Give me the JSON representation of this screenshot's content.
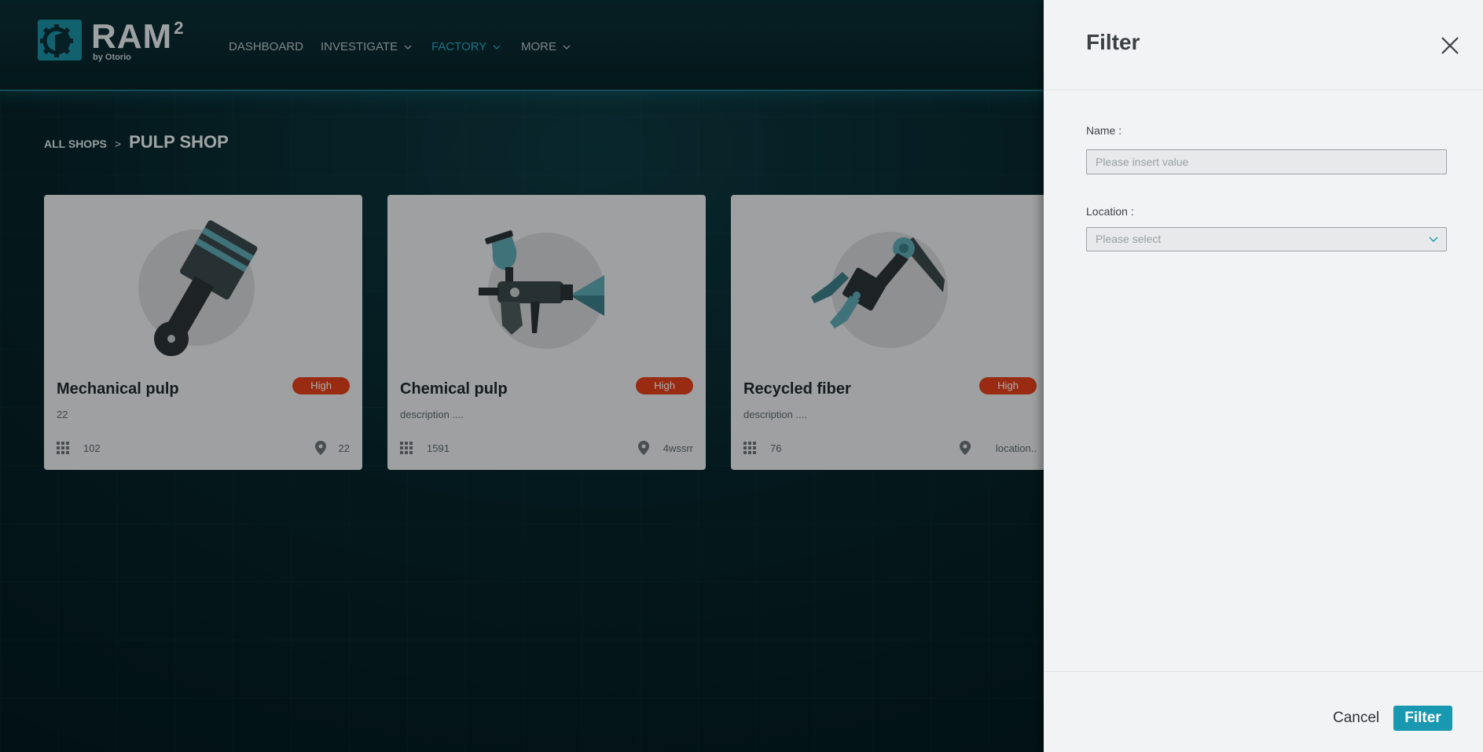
{
  "brand": {
    "name": "RAM",
    "superscript": "2",
    "byline": "by Otorio"
  },
  "nav": {
    "dashboard": "DASHBOARD",
    "investigate": "INVESTIGATE",
    "factory": "FACTORY",
    "more": "MORE",
    "active": "factory",
    "accent_color": "#2aa8c0"
  },
  "breadcrumb": {
    "parent": "ALL SHOPS",
    "separator": ">",
    "current": "PULP SHOP"
  },
  "cards": [
    {
      "title": "Mechanical pulp",
      "badge": "High",
      "description": "22",
      "count": "102",
      "location": "22",
      "icon": "piston-icon"
    },
    {
      "title": "Chemical pulp",
      "badge": "High",
      "description": "description ....",
      "count": "1591",
      "location": "4wssrr",
      "icon": "spray-gun-icon"
    },
    {
      "title": "Recycled fiber",
      "badge": "High",
      "description": "description ....",
      "count": "76",
      "location": "location..",
      "icon": "robot-arm-icon"
    }
  ],
  "badge_color": "#e0401b",
  "filter_panel": {
    "title": "Filter",
    "name_label": "Name :",
    "name_placeholder": "Please insert value",
    "name_value": "",
    "location_label": "Location :",
    "location_placeholder": "Please select",
    "cancel_label": "Cancel",
    "filter_label": "Filter",
    "button_color": "#1998b2"
  }
}
